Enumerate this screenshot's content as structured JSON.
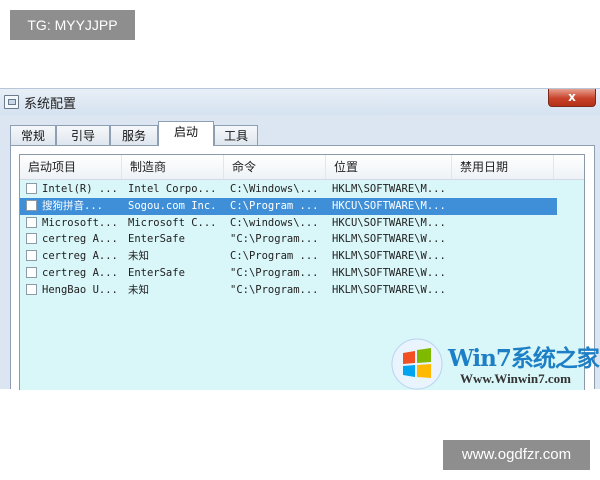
{
  "watermarks": {
    "top": "TG: MYYJJPP",
    "bottom": "www.ogdfzr.com"
  },
  "window": {
    "title": "系统配置",
    "close_glyph": "x",
    "icon": "system-config-icon"
  },
  "tabs": [
    {
      "label": "常规"
    },
    {
      "label": "引导"
    },
    {
      "label": "服务"
    },
    {
      "label": "启动",
      "active": true
    },
    {
      "label": "工具"
    }
  ],
  "startup_table": {
    "columns": [
      "启动项目",
      "制造商",
      "命令",
      "位置",
      "禁用日期"
    ],
    "rows": [
      {
        "item": "Intel(R) ...",
        "maker": "Intel Corpo...",
        "command": "C:\\Windows\\...",
        "location": "HKLM\\SOFTWARE\\M...",
        "disabled_date": "",
        "selected": false
      },
      {
        "item": "搜狗拼音...",
        "maker": "Sogou.com Inc.",
        "command": "C:\\Program ...",
        "location": "HKCU\\SOFTWARE\\M...",
        "disabled_date": "",
        "selected": true
      },
      {
        "item": "Microsoft...",
        "maker": "Microsoft C...",
        "command": "C:\\windows\\...",
        "location": "HKCU\\SOFTWARE\\M...",
        "disabled_date": "",
        "selected": false
      },
      {
        "item": "certreg A...",
        "maker": "EnterSafe",
        "command": "\"C:\\Program...",
        "location": "HKLM\\SOFTWARE\\W...",
        "disabled_date": "",
        "selected": false
      },
      {
        "item": "certreg A...",
        "maker": "未知",
        "command": "C:\\Program ...",
        "location": "HKLM\\SOFTWARE\\W...",
        "disabled_date": "",
        "selected": false
      },
      {
        "item": "certreg A...",
        "maker": "EnterSafe",
        "command": "\"C:\\Program...",
        "location": "HKLM\\SOFTWARE\\W...",
        "disabled_date": "",
        "selected": false
      },
      {
        "item": "HengBao U...",
        "maker": "未知",
        "command": "\"C:\\Program...",
        "location": "HKLM\\SOFTWARE\\W...",
        "disabled_date": "",
        "selected": false
      }
    ]
  },
  "logo": {
    "brand": "Win7系统之家",
    "url": "Www.Winwin7.com"
  },
  "colors": {
    "selected_row": "#3f8fd8",
    "list_background": "#d9f6f8",
    "close_button": "#c8422a"
  }
}
